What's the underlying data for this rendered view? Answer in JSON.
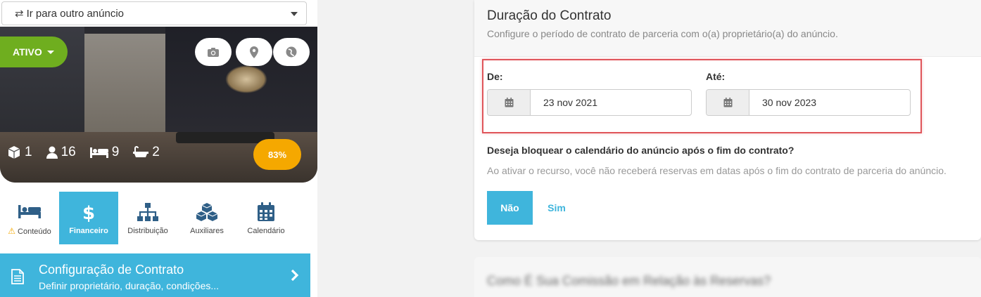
{
  "goto": {
    "label": "Ir para outro anúncio"
  },
  "status": {
    "label": "ATIVO"
  },
  "stats": {
    "units": "1",
    "guests": "16",
    "beds": "9",
    "baths": "2",
    "score": "83%"
  },
  "nav": [
    {
      "label": "Conteúdo",
      "icon": "bed-icon"
    },
    {
      "label": "Financeiro",
      "icon": "dollar-icon"
    },
    {
      "label": "Distribuição",
      "icon": "sitemap-icon"
    },
    {
      "label": "Auxiliares",
      "icon": "cubes-icon"
    },
    {
      "label": "Calendário",
      "icon": "calendar-icon"
    }
  ],
  "config": {
    "title": "Configuração de Contrato",
    "subtitle": "Definir proprietário, duração, condições..."
  },
  "section": {
    "title": "Duração do Contrato",
    "subtitle": "Configure o período de contrato de parceria com o(a) proprietário(a) do anúncio."
  },
  "from": {
    "label": "De:",
    "value": "23 nov 2021"
  },
  "to": {
    "label": "Até:",
    "value": "30 nov 2023"
  },
  "block": {
    "question": "Deseja bloquear o calendário do anúncio após o fim do contrato?",
    "help": "Ao ativar o recurso, você não receberá reservas em datas após o fim do contrato de parceria do anúncio.",
    "no": "Não",
    "yes": "Sim"
  },
  "next_section": {
    "title": "Como É Sua Comissão em Relação às Reservas?"
  },
  "colors": {
    "accent": "#3fb5dc",
    "active_green": "#6fae1f",
    "score_orange": "#f5a800",
    "highlight_red": "#e0555a"
  }
}
